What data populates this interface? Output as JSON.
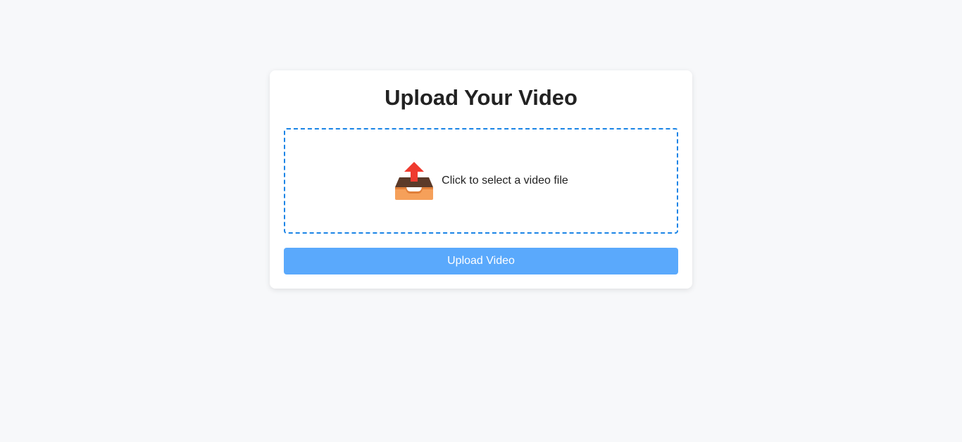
{
  "card": {
    "title": "Upload Your Video"
  },
  "dropzone": {
    "label": "Click to select a video file",
    "icon": "inbox-upload-icon",
    "border_color": "#1a84e6"
  },
  "upload_button": {
    "label": "Upload Video",
    "background": "#5aa9fc",
    "state": "disabled"
  }
}
